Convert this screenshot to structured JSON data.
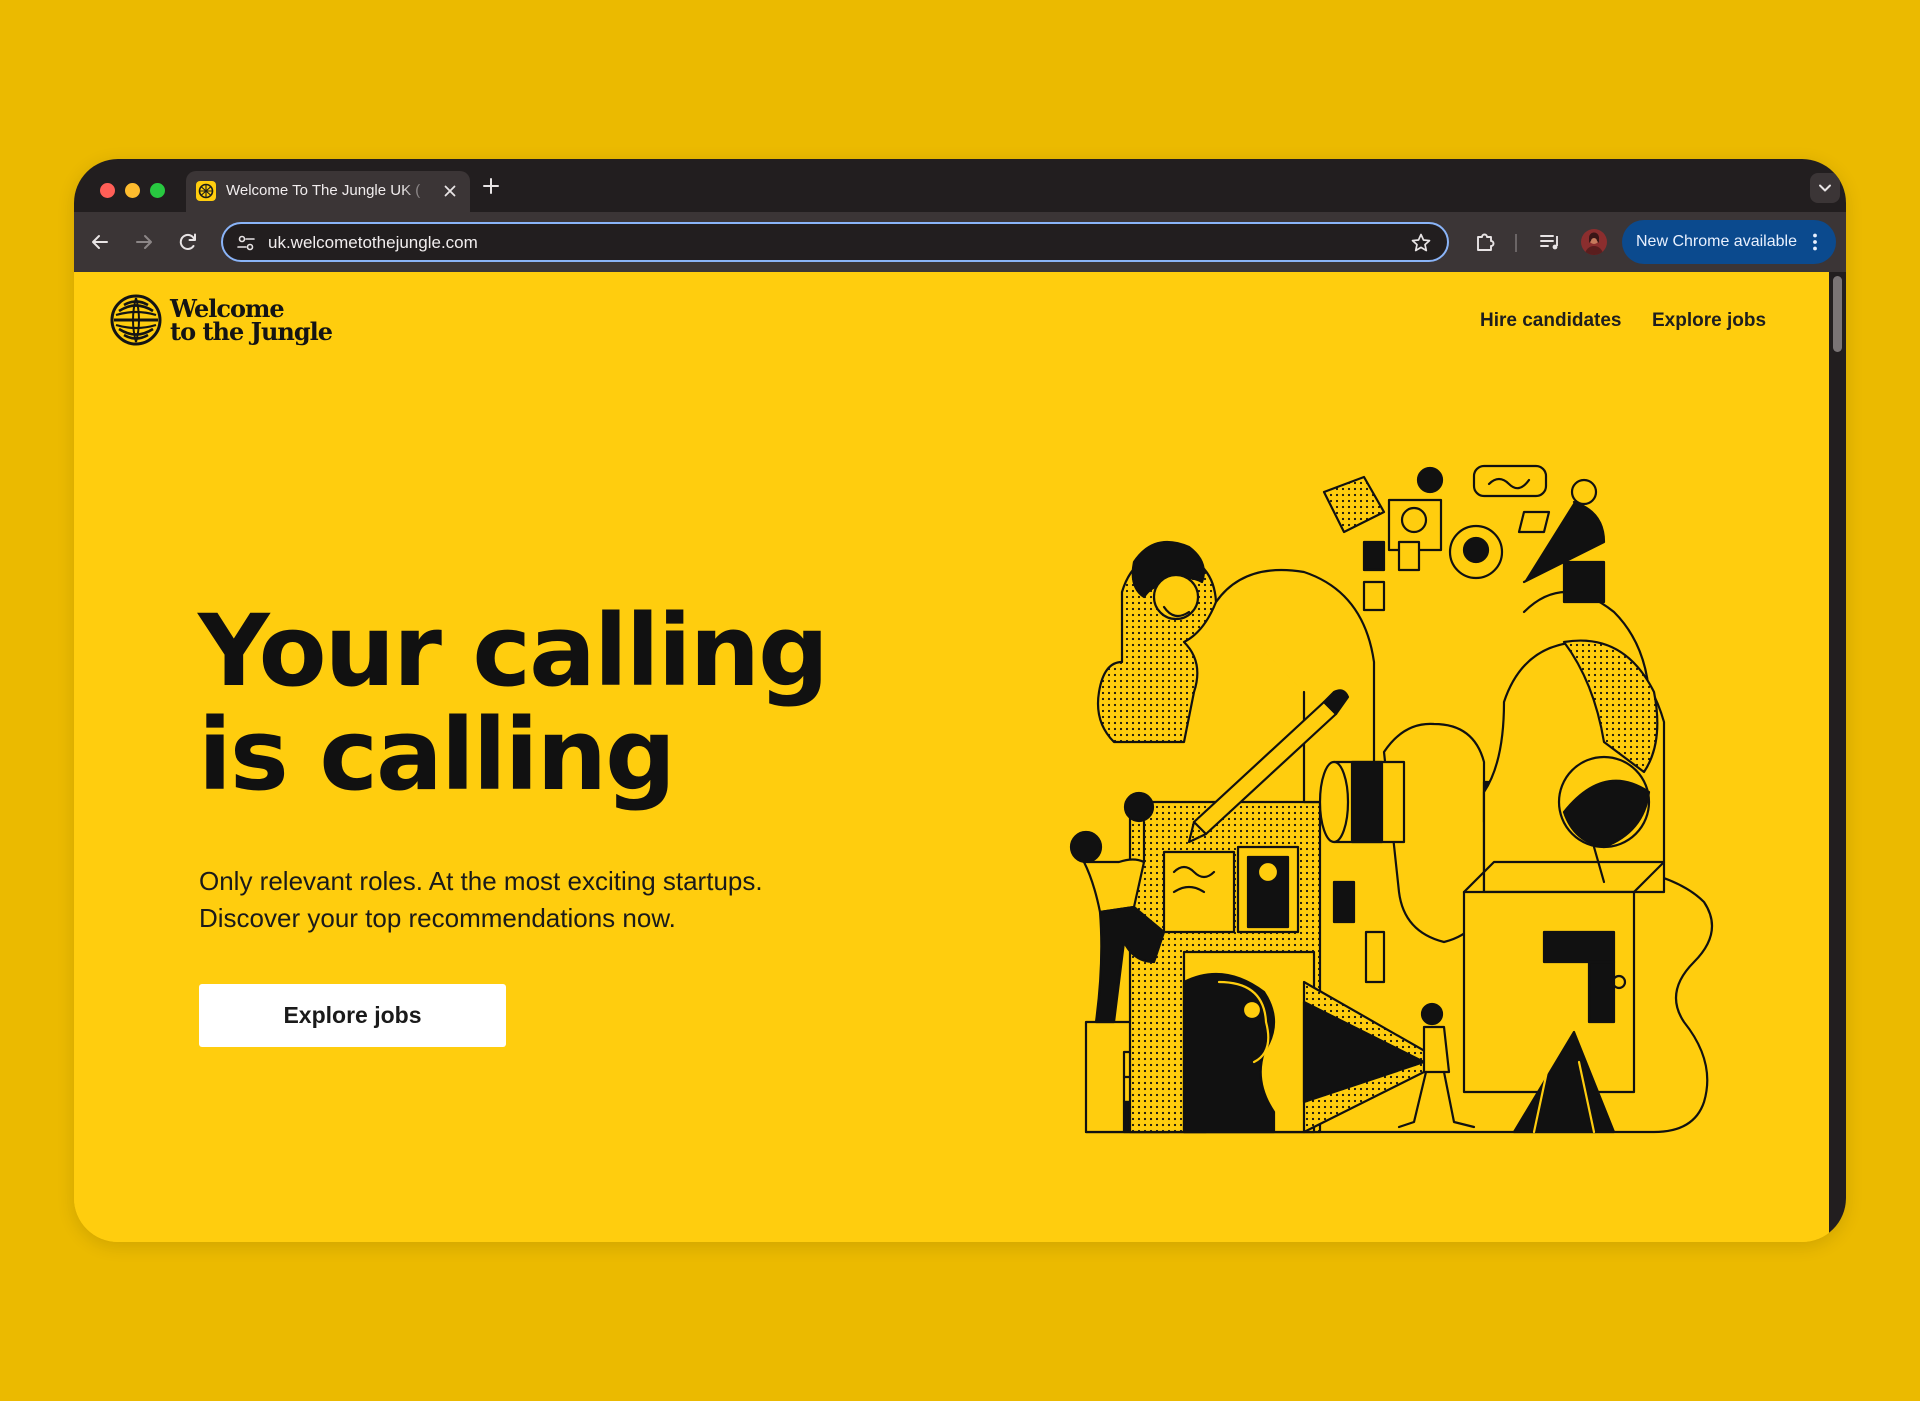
{
  "browser": {
    "tab_title": "Welcome To The Jungle UK (",
    "url": "uk.welcometothejungle.com",
    "update_label": "New Chrome available"
  },
  "site": {
    "logo_line1": "Welcome",
    "logo_line2": "to the Jungle",
    "nav": {
      "hire_label": "Hire candidates",
      "jobs_label": "Explore jobs"
    }
  },
  "hero": {
    "title_line1": "Your calling",
    "title_line2": "is calling",
    "subtitle_line1": "Only relevant roles. At the most exciting startups.",
    "subtitle_line2": "Discover your top recommendations now.",
    "cta_label": "Explore jobs"
  },
  "icons": {
    "back": "arrow-left-icon",
    "forward": "arrow-right-icon",
    "reload": "reload-icon",
    "site_info": "tune-icon",
    "bookmark": "star-icon",
    "extensions": "puzzle-icon",
    "reading_list": "media-queue-icon",
    "menu": "kebab-menu-icon"
  },
  "colors": {
    "backdrop": "#EBBA00",
    "page": "#FFCD0E",
    "chrome_dark": "#221E1F",
    "chrome_toolbar": "#3B3536",
    "update_chip": "#0B4A8E",
    "cta_bg": "#FFFFFF",
    "ink": "#111111"
  }
}
